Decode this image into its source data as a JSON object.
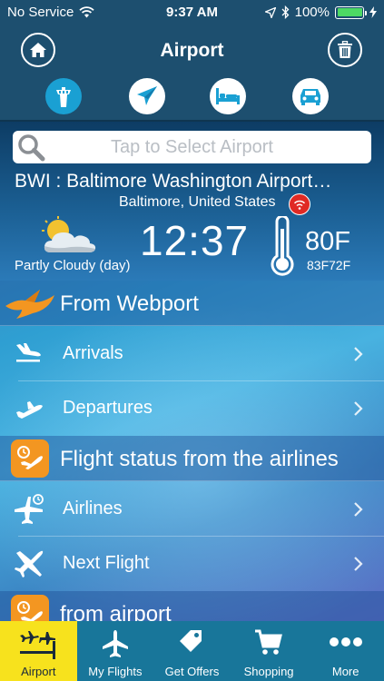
{
  "status_bar": {
    "carrier": "No Service",
    "time": "9:37 AM",
    "battery": "100%",
    "battery_level": 1.0,
    "icons": [
      "wifi-icon",
      "location-arrow-icon",
      "bluetooth-icon",
      "battery-icon",
      "charging-icon"
    ]
  },
  "nav": {
    "title": "Airport",
    "left_icon": "home-icon",
    "right_icon": "trash-icon"
  },
  "category_tabs": [
    {
      "icon": "control-tower-icon",
      "active": true
    },
    {
      "icon": "paper-plane-icon",
      "active": false
    },
    {
      "icon": "bed-icon",
      "active": false
    },
    {
      "icon": "car-icon",
      "active": false
    }
  ],
  "search": {
    "placeholder": "Tap to Select Airport"
  },
  "airport": {
    "name": "BWI : Baltimore Washington Airport…",
    "city": "Baltimore, United States"
  },
  "weather": {
    "description": "Partly Cloudy (day)",
    "local_time": "12:37",
    "temperature": "80F",
    "high": "83F",
    "low": "72F"
  },
  "sections": [
    {
      "header": "From Webport",
      "header_icon": "bird-logo-icon",
      "rows": [
        {
          "label": "Arrivals",
          "icon": "plane-landing-icon"
        },
        {
          "label": "Departures",
          "icon": "plane-takeoff-icon"
        }
      ]
    },
    {
      "header": "Flight status from the airlines",
      "header_icon": "flight-clock-icon",
      "rows": [
        {
          "label": "Airlines",
          "icon": "plane-clock-icon"
        },
        {
          "label": "Next Flight",
          "icon": "plane-icon"
        }
      ]
    },
    {
      "header": "from airport",
      "header_icon": "flight-clock-icon",
      "rows": []
    }
  ],
  "tab_bar": [
    {
      "label": "Airport",
      "icon": "airport-icon",
      "selected": true
    },
    {
      "label": "My Flights",
      "icon": "plane-icon",
      "selected": false
    },
    {
      "label": "Get Offers",
      "icon": "tag-icon",
      "selected": false
    },
    {
      "label": "Shopping",
      "icon": "cart-icon",
      "selected": false
    },
    {
      "label": "More",
      "icon": "more-dots-icon",
      "selected": false
    }
  ],
  "colors": {
    "nav_bg": "#1d4f6f",
    "accent_blue": "#1aa0d3",
    "orange": "#f39621",
    "tab_bar_bg": "#18769a",
    "tab_selected": "#f7e21d",
    "badge_red": "#e02a24"
  }
}
